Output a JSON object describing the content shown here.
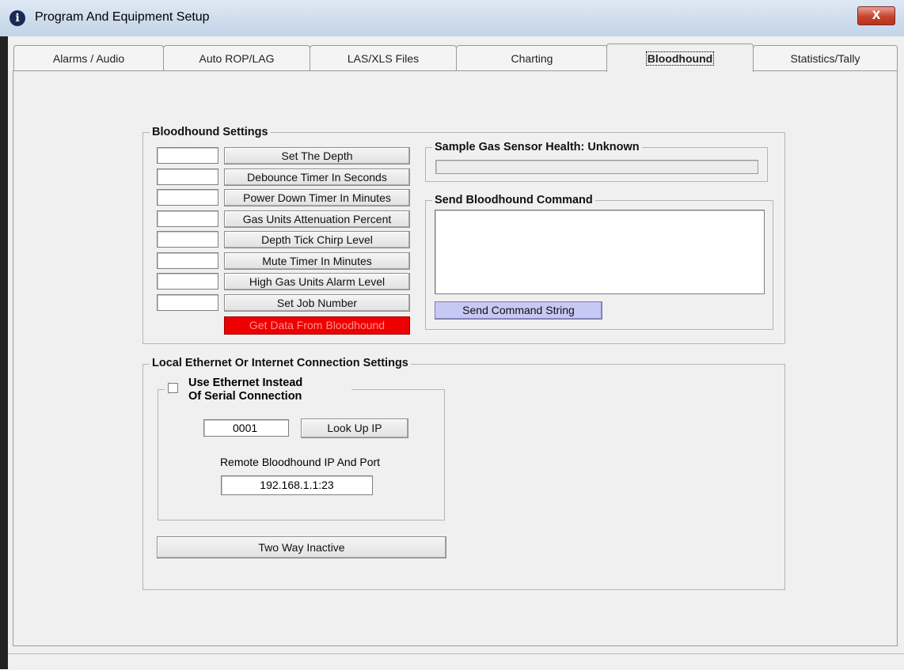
{
  "window": {
    "title": "Program And Equipment Setup",
    "close_label": "X"
  },
  "tabs": [
    {
      "label": "Alarms / Audio"
    },
    {
      "label": "Auto ROP/LAG"
    },
    {
      "label": "LAS/XLS Files"
    },
    {
      "label": "Charting"
    },
    {
      "label": "Bloodhound"
    },
    {
      "label": "Statistics/Tally"
    }
  ],
  "active_tab": "Bloodhound",
  "bloodhound_settings": {
    "title": "Bloodhound Settings",
    "rows": [
      {
        "label": "Set The Depth",
        "value": ""
      },
      {
        "label": "Debounce Timer In Seconds",
        "value": ""
      },
      {
        "label": "Power Down Timer In Minutes",
        "value": ""
      },
      {
        "label": "Gas Units Attenuation Percent",
        "value": ""
      },
      {
        "label": "Depth Tick Chirp Level",
        "value": ""
      },
      {
        "label": "Mute Timer In Minutes",
        "value": ""
      },
      {
        "label": "High Gas Units Alarm Level",
        "value": ""
      },
      {
        "label": "Set Job Number",
        "value": ""
      }
    ],
    "get_data_label": "Get Data From Bloodhound",
    "get_data_color": "#ee0000",
    "sensor_health": {
      "title": "Sample Gas Sensor Health: Unknown",
      "progress": 0
    },
    "send_command": {
      "title": "Send Bloodhound Command",
      "value": "",
      "button_label": "Send Command String",
      "button_color": "#c8c8f5"
    }
  },
  "ethernet": {
    "title": "Local Ethernet Or Internet Connection Settings",
    "use_ethernet_line1": "Use Ethernet Instead",
    "use_ethernet_line2": "Of Serial Connection",
    "use_ethernet_checked": false,
    "id_value": "0001",
    "lookup_label": "Look Up IP",
    "remote_label": "Remote Bloodhound IP And Port",
    "remote_value": "192.168.1.1:23",
    "two_way_label": "Two Way Inactive"
  }
}
